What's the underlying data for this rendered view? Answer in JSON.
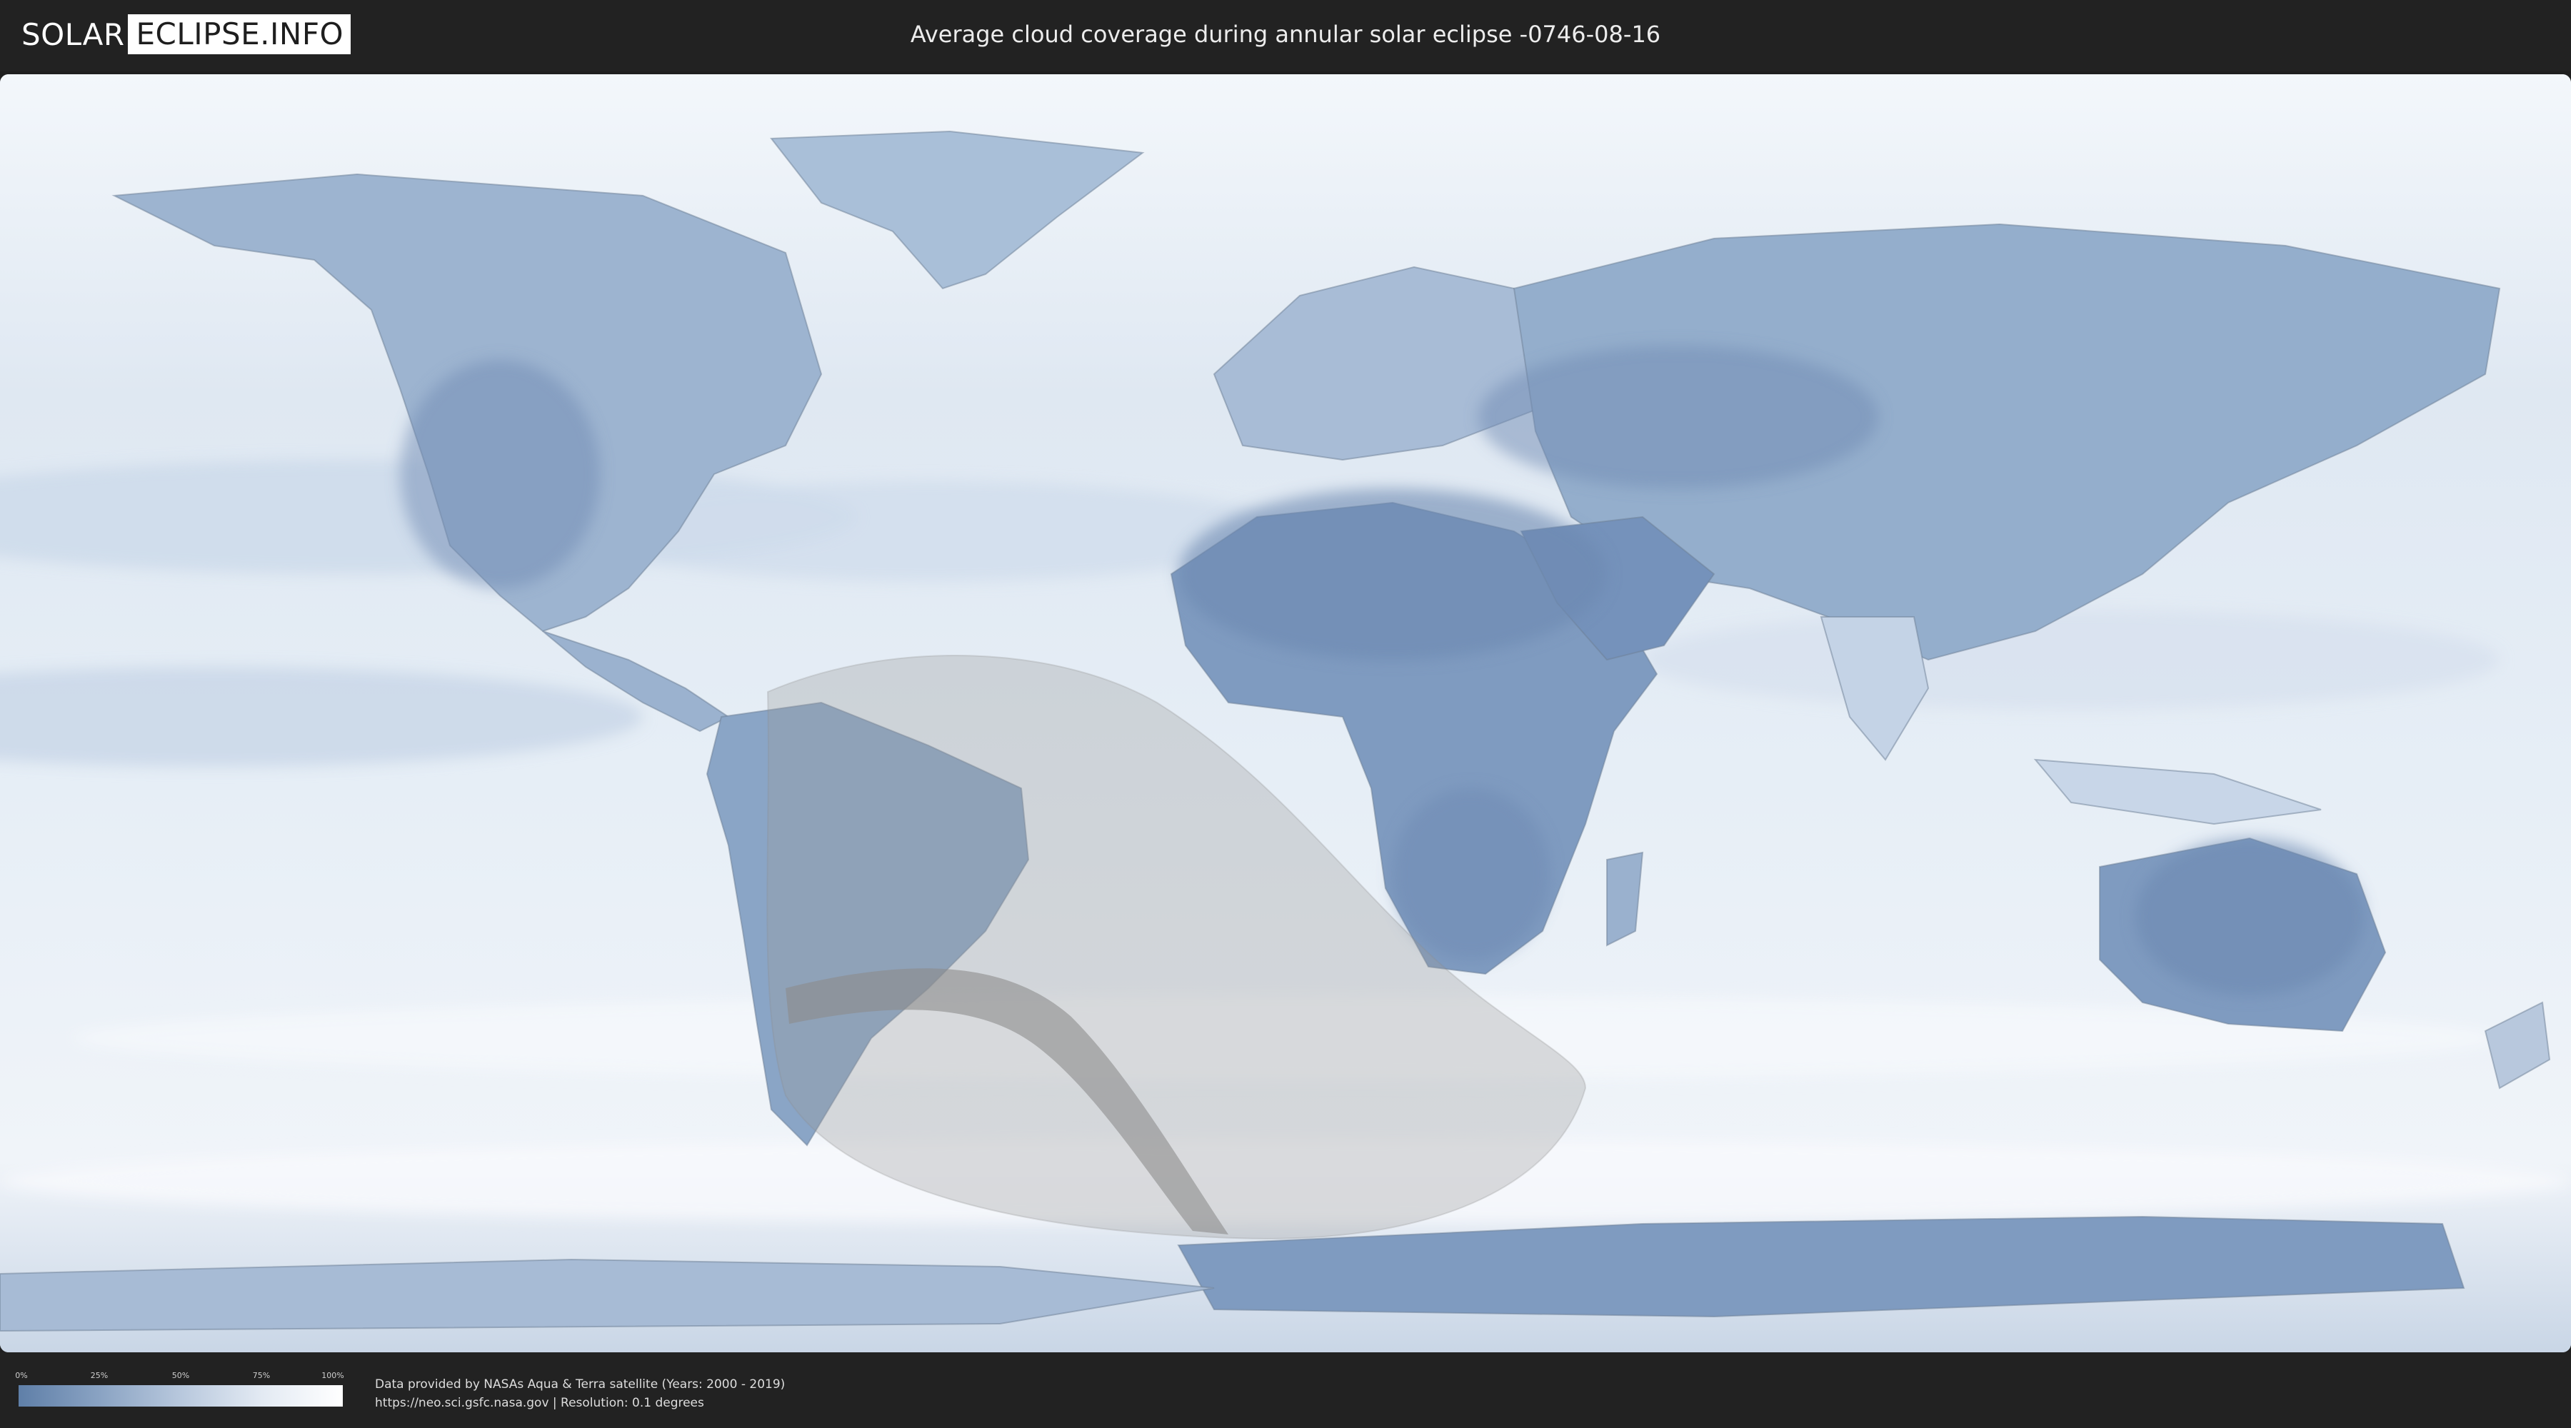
{
  "header": {
    "logo_part1": "SOLAR",
    "logo_part2": "ECLIPSE.INFO",
    "title": "Average cloud coverage during annular solar eclipse -0746-08-16"
  },
  "legend": {
    "ticks": [
      "0%",
      "25%",
      "50%",
      "75%",
      "100%"
    ],
    "color_low": "#5f7fa8",
    "color_high": "#ffffff"
  },
  "footer": {
    "line1": "Data provided by NASAs Aqua & Terra satellite (Years: 2000 - 2019)",
    "line2": "https://neo.sci.gsfc.nasa.gov | Resolution: 0.1 degrees"
  },
  "colors": {
    "ocean_cloudy": "#e9f0f7",
    "land_clear": "#6f8db5",
    "eclipse_shadow": "#9a9a9a"
  }
}
